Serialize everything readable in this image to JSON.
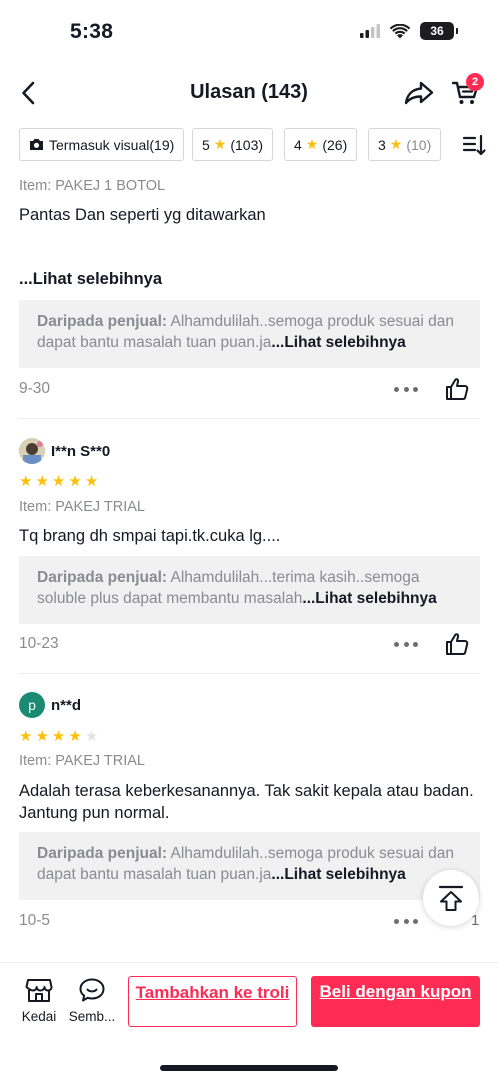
{
  "status_bar": {
    "time": "5:38",
    "battery": "36"
  },
  "header": {
    "title": "Ulasan (143)",
    "cart_badge": "2"
  },
  "filters": {
    "visual": "Termasuk visual(19)",
    "star5_num": "5",
    "star5_count": "(103)",
    "star4_num": "4",
    "star4_count": "(26)",
    "star3_num": "3",
    "star3_count": "(10)"
  },
  "reviews": [
    {
      "item": "Item: PAKEJ 1 BOTOL",
      "text": "Pantas Dan seperti yg ditawarkan",
      "see_more": "...Lihat selebihnya",
      "seller_label": "Daripada penjual:",
      "seller_text": " Alhamdulilah..semoga produk sesuai dan dapat bantu masalah tuan puan.ja",
      "seller_more": "...Lihat selebihnya",
      "date": "9-30"
    },
    {
      "username": "I**n S**0",
      "rating": 5,
      "item": "Item: PAKEJ TRIAL",
      "text": "Tq brang dh smpai tapi.tk.cuka lg....",
      "seller_label": "Daripada penjual:",
      "seller_text": " Alhamdulilah...terima kasih..semoga soluble plus dapat membantu masalah",
      "seller_more": "...Lihat selebihnya",
      "date": "10-23"
    },
    {
      "username": "n**d",
      "avatar_letter": "p",
      "rating": 4,
      "item": "Item: PAKEJ TRIAL",
      "text": "Adalah terasa keberkesanannya. Tak sakit kepala atau badan. Jantung pun normal.",
      "seller_label": "Daripada penjual:",
      "seller_text": " Alhamdulilah..semoga produk sesuai dan dapat bantu masalah tuan puan.ja",
      "seller_more": "...Lihat selebihnya",
      "date": "10-5",
      "like_count": "1"
    }
  ],
  "bottom_bar": {
    "shop_label": "Kedai",
    "chat_label": "Semb...",
    "add_to_cart": "Tambahkan ke troli",
    "buy": "Beli dengan kupon"
  },
  "colors": {
    "accent": "#fe2c55",
    "star": "#fcbf0a",
    "avatar_p": "#1a8a73"
  },
  "icons": [
    "signal-icon",
    "wifi-icon",
    "battery-icon",
    "back-chevron-icon",
    "share-icon",
    "cart-icon",
    "camera-icon",
    "star-icon",
    "sort-icon",
    "more-dots-icon",
    "thumbs-up-icon",
    "scroll-top-icon",
    "shop-icon",
    "chat-icon"
  ]
}
